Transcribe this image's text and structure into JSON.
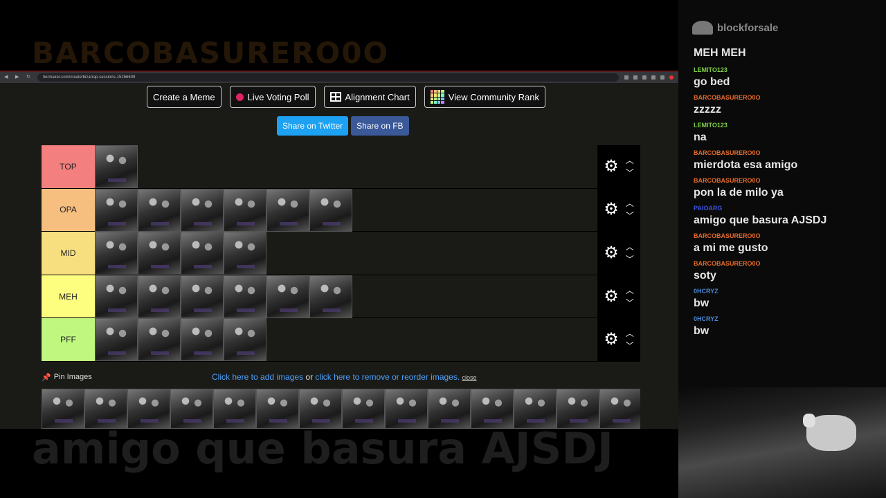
{
  "overlay": {
    "top_title": "BARCOBASURERO0O",
    "subtitle": "amigo que basura AJSDJ"
  },
  "browser": {
    "url": "tiermaker.com/create/bizarrap-sessions-15266609"
  },
  "toolbar": {
    "create_meme": "Create a Meme",
    "live_poll": "Live Voting Poll",
    "alignment": "Alignment Chart",
    "community_rank": "View Community Rank"
  },
  "share": {
    "twitter": "Share on Twitter",
    "fb": "Share on FB"
  },
  "tiers": [
    {
      "label": "TOP",
      "color": "#f47f7f",
      "count": 1
    },
    {
      "label": "OPA",
      "color": "#f7bf7f",
      "count": 6
    },
    {
      "label": "MID",
      "color": "#f7df7f",
      "count": 4
    },
    {
      "label": "MEH",
      "color": "#fdfd7f",
      "count": 6
    },
    {
      "label": "PFF",
      "color": "#bff77f",
      "count": 4
    }
  ],
  "pin": {
    "label": "Pin Images",
    "add_link": "Click here to add images",
    "or": " or ",
    "remove_link": "click here to remove or reorder images.",
    "close": "close"
  },
  "pool_count": 14,
  "chat": {
    "logo": "blockforsale",
    "first_message": "MEH MEH",
    "messages": [
      {
        "user": "LEMITO123",
        "color": "#7fd04a",
        "text": "go bed"
      },
      {
        "user": "BARCOBASURERO0O",
        "color": "#e06a2a",
        "text": "zzzzz"
      },
      {
        "user": "LEMITO123",
        "color": "#7fd04a",
        "text": "na"
      },
      {
        "user": "BARCOBASURERO0O",
        "color": "#e06a2a",
        "text": "mierdota esa amigo"
      },
      {
        "user": "BARCOBASURERO0O",
        "color": "#e06a2a",
        "text": "pon la de milo ya"
      },
      {
        "user": "PAIOARG",
        "color": "#3a52d8",
        "text": "amigo que basura AJSDJ"
      },
      {
        "user": "BARCOBASURERO0O",
        "color": "#e06a2a",
        "text": "a mi me gusto"
      },
      {
        "user": "BARCOBASURERO0O",
        "color": "#e06a2a",
        "text": "soty"
      },
      {
        "user": "0HCRYZ",
        "color": "#4a8ad8",
        "text": "bw"
      },
      {
        "user": "0HCRYZ",
        "color": "#4a8ad8",
        "text": "bw"
      }
    ]
  }
}
